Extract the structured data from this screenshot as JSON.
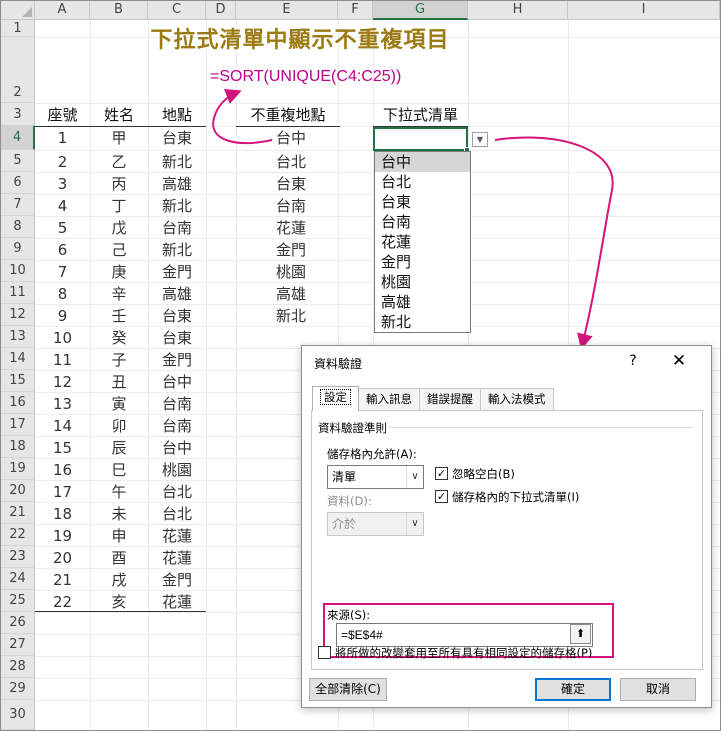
{
  "columns": [
    "A",
    "B",
    "C",
    "D",
    "E",
    "F",
    "G",
    "H",
    "I"
  ],
  "selected_column": "G",
  "rows": [
    "1",
    "2",
    "3",
    "4",
    "5",
    "6",
    "7",
    "8",
    "9",
    "10",
    "11",
    "12",
    "13",
    "14",
    "15",
    "16",
    "17",
    "18",
    "19",
    "20",
    "21",
    "22",
    "23",
    "24",
    "25",
    "26",
    "27",
    "28",
    "29",
    "30"
  ],
  "selected_row": "4",
  "title": "下拉式清單中顯示不重複項目",
  "formula": "=SORT(UNIQUE(C4:C25))",
  "table": {
    "headers": [
      "座號",
      "姓名",
      "地點"
    ],
    "rows": [
      [
        "1",
        "甲",
        "台東"
      ],
      [
        "2",
        "乙",
        "新北"
      ],
      [
        "3",
        "丙",
        "高雄"
      ],
      [
        "4",
        "丁",
        "新北"
      ],
      [
        "5",
        "戊",
        "台南"
      ],
      [
        "6",
        "己",
        "新北"
      ],
      [
        "7",
        "庚",
        "金門"
      ],
      [
        "8",
        "辛",
        "高雄"
      ],
      [
        "9",
        "壬",
        "台東"
      ],
      [
        "10",
        "癸",
        "台東"
      ],
      [
        "11",
        "子",
        "金門"
      ],
      [
        "12",
        "丑",
        "台中"
      ],
      [
        "13",
        "寅",
        "台南"
      ],
      [
        "14",
        "卯",
        "台南"
      ],
      [
        "15",
        "辰",
        "台中"
      ],
      [
        "16",
        "巳",
        "桃園"
      ],
      [
        "17",
        "午",
        "台北"
      ],
      [
        "18",
        "未",
        "台北"
      ],
      [
        "19",
        "申",
        "花蓮"
      ],
      [
        "20",
        "酉",
        "花蓮"
      ],
      [
        "21",
        "戌",
        "金門"
      ],
      [
        "22",
        "亥",
        "花蓮"
      ]
    ]
  },
  "unique": {
    "header": "不重複地點",
    "values": [
      "台中",
      "台北",
      "台東",
      "台南",
      "花蓮",
      "金門",
      "桃園",
      "高雄",
      "新北"
    ]
  },
  "dropdown": {
    "header": "下拉式清單",
    "button_glyph": "▼",
    "items": [
      "台中",
      "台北",
      "台東",
      "台南",
      "花蓮",
      "金門",
      "桃園",
      "高雄",
      "新北"
    ],
    "highlighted_index": 0
  },
  "dialog": {
    "title": "資料驗證",
    "help": "?",
    "close": "✕",
    "tabs": [
      "設定",
      "輸入訊息",
      "錯誤提醒",
      "輸入法模式"
    ],
    "active_tab": "設定",
    "section_label": "資料驗證準則",
    "allow_label": "儲存格內允許(A):",
    "allow_value": "清單",
    "data_label": "資料(D):",
    "data_value": "介於",
    "ignore_blank_label": "忽略空白(B)",
    "ignore_blank_checked": true,
    "in_cell_dropdown_label": "儲存格內的下拉式清單(I)",
    "in_cell_dropdown_checked": true,
    "source_label": "來源(S):",
    "source_value": "=$E$4#",
    "source_button_glyph": "⬆",
    "apply_all_label": "將所做的改變套用至所有具有相同設定的儲存格(P)",
    "apply_all_checked": false,
    "clear_all_button": "全部清除(C)",
    "ok_button": "確定",
    "cancel_button": "取消",
    "check_glyph": "✓",
    "combo_arrow_glyph": "∨"
  },
  "colors": {
    "title": "#9c7a12",
    "formula": "#c0008a",
    "highlight_box": "#d4147a",
    "selection": "#217346",
    "default_button": "#0078d7"
  }
}
